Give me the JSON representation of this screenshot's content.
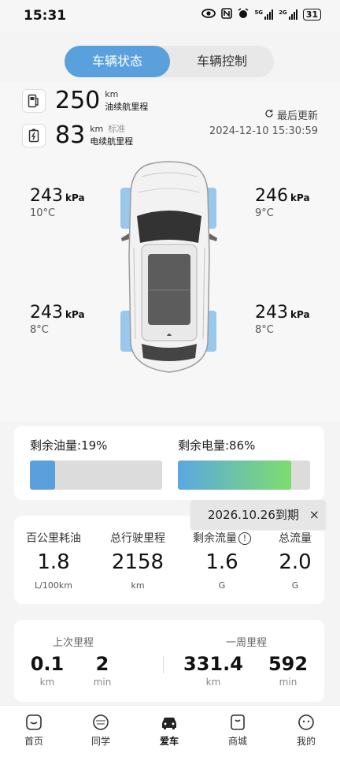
{
  "status_bar": {
    "time": "15:31",
    "battery": "31",
    "sig1": "5G",
    "sig2": "2G"
  },
  "tabs": {
    "active": "车辆状态",
    "inactive": "车辆控制"
  },
  "fuel_range": {
    "value": "250",
    "unit": "km",
    "label": "油续航里程"
  },
  "electric_range": {
    "value": "83",
    "unit": "km",
    "standard": "标准",
    "label": "电续航里程"
  },
  "update": {
    "label": "最后更新",
    "timestamp": "2024-12-10 15:30:59"
  },
  "tires": {
    "front_left": {
      "pressure": "243",
      "unit": "kPa",
      "temp": "10°C"
    },
    "front_right": {
      "pressure": "246",
      "unit": "kPa",
      "temp": "9°C"
    },
    "rear_left": {
      "pressure": "243",
      "unit": "kPa",
      "temp": "8°C"
    },
    "rear_right": {
      "pressure": "243",
      "unit": "kPa",
      "temp": "8°C"
    }
  },
  "fuel_level": {
    "label": "剩余油量:19%",
    "fraction": 0.19,
    "color": "#5aa0dc"
  },
  "battery_level": {
    "label": "剩余电量:86%",
    "fraction": 0.86,
    "gradient_from": "#5aa8e0",
    "gradient_to": "#7edc6e"
  },
  "expiry": {
    "text": "2026.10.26到期",
    "close": "×"
  },
  "stats": [
    {
      "label": "百公里耗油",
      "value": "1.8",
      "unit": "L/100km"
    },
    {
      "label": "总行驶里程",
      "value": "2158",
      "unit": "km"
    },
    {
      "label": "剩余流量",
      "value": "1.6",
      "unit": "G",
      "info": "!"
    },
    {
      "label": "总流量",
      "value": "2.0",
      "unit": "G"
    }
  ],
  "trips": {
    "last": {
      "title": "上次里程",
      "distance": "0.1",
      "distance_unit": "km",
      "time": "2",
      "time_unit": "min"
    },
    "week": {
      "title": "一周里程",
      "distance": "331.4",
      "distance_unit": "km",
      "time": "592",
      "time_unit": "min"
    }
  },
  "nav": [
    {
      "label": "首页",
      "icon": "home-icon"
    },
    {
      "label": "同学",
      "icon": "friends-icon"
    },
    {
      "label": "爱车",
      "icon": "car-icon",
      "active": true
    },
    {
      "label": "商城",
      "icon": "shop-icon"
    },
    {
      "label": "我的",
      "icon": "profile-icon"
    }
  ]
}
